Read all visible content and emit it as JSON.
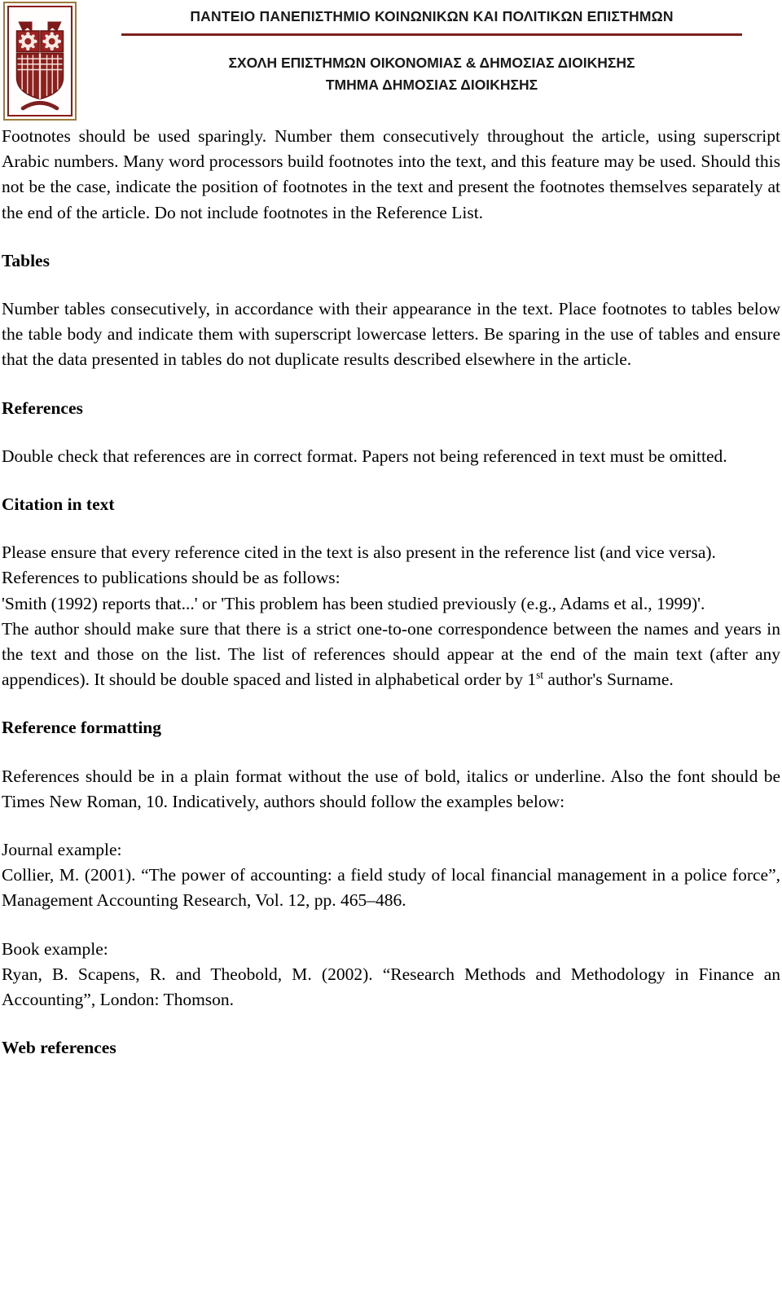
{
  "header": {
    "logo_name": "panteion-university-owl-emblem",
    "university_name": "ΠΑΝΤΕΙΟ ΠΑΝΕΠΙΣΤΗΜΙΟ ΚΟΙΝΩΝΙΚΩΝ ΚΑΙ ΠΟΛΙΤΙΚΩΝ ΕΠΙΣΤΗΜΩΝ",
    "school_name": "ΣΧΟΛΗ ΕΠΙΣΤΗΜΩΝ ΟΙΚΟΝΟΜΙΑΣ & ΔΗΜΟΣΙΑΣ ΔΙΟΙΚΗΣΗΣ",
    "department_name": "ΤΜΗΜΑ ΔΗΜΟΣΙΑΣ ΔΙΟΙΚΗΣΗΣ",
    "rule_color": "#7c1f1f",
    "logo_border_color": "#9c7a3c",
    "logo_accent_color": "#8b1c1c"
  },
  "body": {
    "footnotes_paragraph": "Footnotes should be used sparingly. Number them consecutively throughout the article, using superscript Arabic numbers. Many word processors build footnotes into the text, and this feature may be used. Should this not be the case, indicate the position of footnotes in the text and present the footnotes themselves separately at the end of the article. Do not include footnotes in the Reference List.",
    "tables_heading": "Tables",
    "tables_paragraph": "Number tables consecutively, in accordance with their appearance in the text. Place footnotes to tables below the table body and indicate them with superscript lowercase letters. Be sparing in the use of tables and ensure that the data presented in tables do not duplicate results described elsewhere in the article.",
    "references_heading": "References",
    "references_paragraph": "Double check that references are in correct format. Papers not being referenced in text must be omitted.",
    "citation_heading": "Citation in text",
    "citation_paragraph_1": "Please ensure that every reference cited in the text is also present in the reference list (and vice versa). References to publications should be as follows:",
    "citation_paragraph_2": "'Smith (1992) reports that...' or 'This problem has been studied previously (e.g., Adams et al., 1999)'.",
    "citation_paragraph_3_prefix": "The author should make sure that there is a strict one-to-one correspondence between the names and years in the text and those on the list. The list of references should appear at the end of the main text (after any appendices). It should be double spaced and listed in alphabetical order by 1",
    "citation_ordinal_suffix": "st",
    "citation_paragraph_3_suffix": " author's Surname.",
    "reference_formatting_heading": "Reference formatting",
    "reference_formatting_paragraph": "References should be in a plain format without the use of bold, italics or underline. Also the font should be Times New Roman, 10. Indicatively, authors should follow the examples below:",
    "journal_example_label": "Journal example:",
    "journal_example_text": "Collier, M. (2001). “The power of accounting: a field study of local financial management in a police force”, Management Accounting Research, Vol. 12, pp. 465–486.",
    "book_example_label": "Book example:",
    "book_example_text": "Ryan, B. Scapens, R. and Theobold, M. (2002). “Research Methods and Methodology in Finance an Accounting”, London: Thomson.",
    "web_references_heading": "Web references"
  }
}
